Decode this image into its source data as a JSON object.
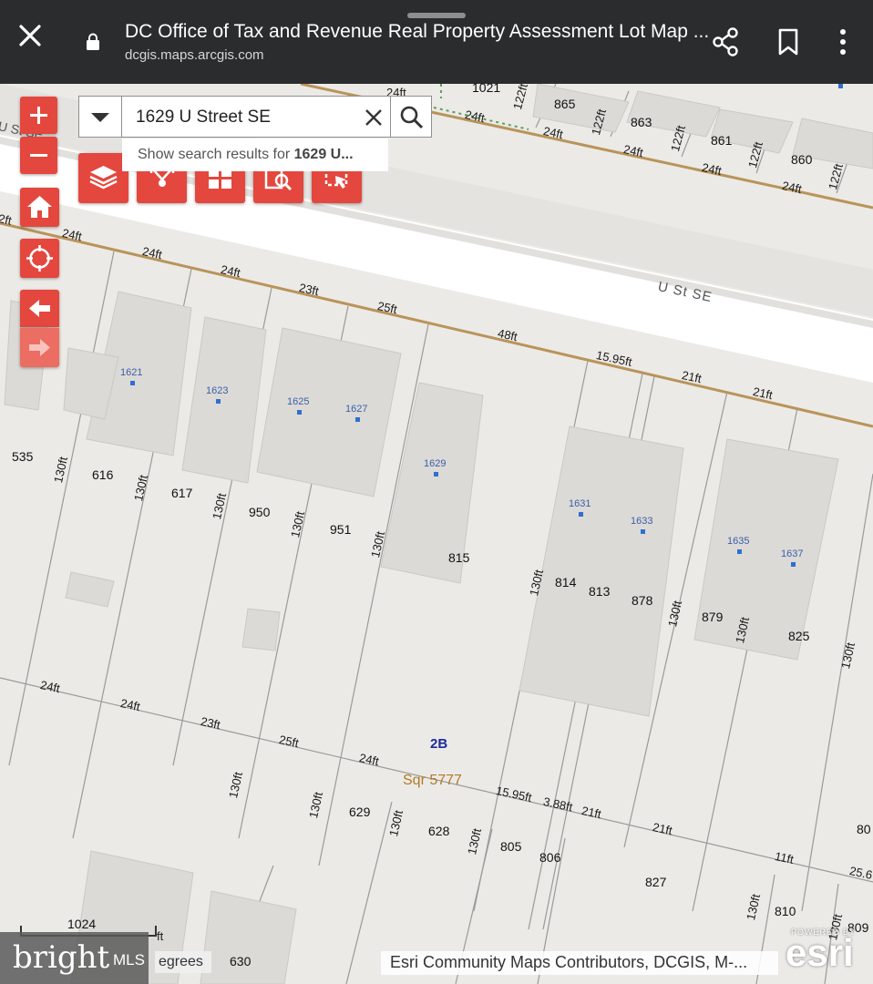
{
  "browser": {
    "title": "DC Office of Tax and Revenue Real Property Assessment Lot Map ...",
    "url": "dcgis.maps.arcgis.com",
    "close_icon": "close-icon",
    "lock_icon": "lock-icon",
    "share_icon": "share-icon",
    "bookmark_icon": "bookmark-icon",
    "more_icon": "more-vert-icon"
  },
  "search": {
    "value": "1629 U Street SE",
    "suggestion_prefix": "Show search results for ",
    "suggestion_bold": "1629 U..."
  },
  "map_controls": {
    "zoom_in": "+",
    "zoom_out": "−",
    "tools": [
      "layers-icon",
      "route-icon",
      "grid-icon",
      "identify-icon",
      "select-icon"
    ],
    "home": "home-icon",
    "locate": "locate-icon",
    "back": "arrow-left-icon",
    "forward": "arrow-right-icon"
  },
  "map": {
    "street_labels": [
      "U St SE",
      "U St SE"
    ],
    "square_label": "Sqr 5777",
    "ward_label": "2B",
    "dimension_labels": [
      "24ft",
      "24ft",
      "122ft",
      "24ft",
      "122ft",
      "24ft",
      "122ft",
      "24ft",
      "122ft",
      "24ft",
      "122ft",
      "2ft",
      "24ft",
      "24ft",
      "24ft",
      "23ft",
      "25ft",
      "48ft",
      "15.95ft",
      "21ft",
      "21ft",
      "130ft",
      "130ft",
      "130ft",
      "130ft",
      "130ft",
      "130ft",
      "130ft",
      "130ft",
      "130ft",
      "24ft",
      "24ft",
      "23ft",
      "25ft",
      "24ft",
      "15.95ft",
      "3.88ft",
      "21ft",
      "21ft",
      "11ft",
      "25.6",
      "130ft",
      "130ft",
      "130ft",
      "130ft",
      "130ft",
      "130ft",
      "ft"
    ],
    "lot_numbers": [
      "1021",
      "865",
      "863",
      "861",
      "860",
      "535",
      "616",
      "617",
      "950",
      "951",
      "815",
      "814",
      "813",
      "878",
      "879",
      "825",
      "629",
      "628",
      "805",
      "806",
      "827",
      "810",
      "809",
      "80",
      "1024",
      "630"
    ],
    "addresses": [
      "1621",
      "1623",
      "1625",
      "1627",
      "1629",
      "1631",
      "1633",
      "1635",
      "1637"
    ]
  },
  "footer": {
    "scale_text": "egrees",
    "brand": "bright",
    "brand_suffix": "MLS",
    "attribution": "Esri Community Maps Contributors, DCGIS, M-...",
    "powered_by": "POWERED BY",
    "esri_logo": "esri"
  },
  "colors": {
    "topbar": "#2b2c2e",
    "control_red": "#e4473e",
    "street": "#ffffff",
    "lot_line": "#b8945a",
    "square_label": "#b07a28",
    "ward_label": "#1b2c9c",
    "address": "#3a5fa8"
  }
}
